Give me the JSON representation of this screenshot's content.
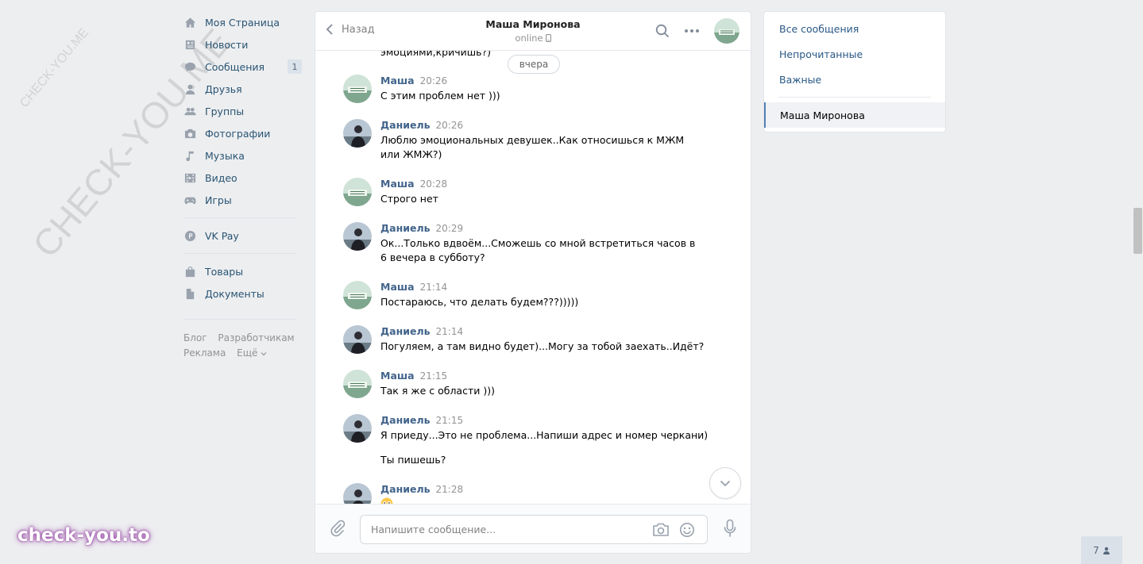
{
  "watermark": {
    "small": "CHECK-YOU.ME",
    "large": "CHECK-YOU.ME",
    "brand": "check-you.to"
  },
  "nav": {
    "items": [
      {
        "label": "Моя Страница",
        "icon": "home-icon"
      },
      {
        "label": "Новости",
        "icon": "news-icon"
      },
      {
        "label": "Сообщения",
        "icon": "messages-icon",
        "badge": "1"
      },
      {
        "label": "Друзья",
        "icon": "friend-icon"
      },
      {
        "label": "Группы",
        "icon": "groups-icon"
      },
      {
        "label": "Фотографии",
        "icon": "camera-icon"
      },
      {
        "label": "Музыка",
        "icon": "music-icon"
      },
      {
        "label": "Видео",
        "icon": "video-icon"
      },
      {
        "label": "Игры",
        "icon": "gamepad-icon"
      }
    ],
    "vkpay": {
      "label": "VK Pay",
      "icon": "vkpay-icon"
    },
    "extra": [
      {
        "label": "Товары",
        "icon": "bag-icon"
      },
      {
        "label": "Документы",
        "icon": "document-icon"
      }
    ],
    "footer": {
      "blog": "Блог",
      "dev": "Разработчикам",
      "ads": "Реклама",
      "more": "Ещё"
    }
  },
  "chat": {
    "back_label": "Назад",
    "peer_name": "Маша Миронова",
    "peer_status": "online",
    "cut_text": "эмоциями,кричишь?)",
    "date_pill": "вчера",
    "messages": [
      {
        "author": "Маша",
        "time": "20:26",
        "text": "С этим проблем нет )))"
      },
      {
        "author": "Даниель",
        "time": "20:26",
        "text": "Люблю эмоциональных девушек..Как относишься к МЖМ или ЖМЖ?)"
      },
      {
        "author": "Маша",
        "time": "20:28",
        "text": "Строго нет"
      },
      {
        "author": "Даниель",
        "time": "20:29",
        "text": "Ок...Только вдвоём...Сможешь со мной встретиться часов в 6 вечера в субботу?"
      },
      {
        "author": "Маша",
        "time": "21:14",
        "text": "Постараюсь, что делать будем???)))))"
      },
      {
        "author": "Даниель",
        "time": "21:14",
        "text": "Погуляем, а там видно будет)...Могу за тобой заехать..Идёт?"
      },
      {
        "author": "Маша",
        "time": "21:15",
        "text": "Так я же с области )))"
      },
      {
        "author": "Даниель",
        "time": "21:15",
        "text": "Я приеду...Это не проблема...Напиши адрес и номер черкани)",
        "text2": "Ты пишешь?"
      },
      {
        "author": "Даниель",
        "time": "21:28",
        "text": ""
      }
    ],
    "composer_placeholder": "Напишите сообщение..."
  },
  "filters": {
    "all": "Все сообщения",
    "unread": "Непрочитанные",
    "important": "Важные",
    "active": "Маша Миронова"
  },
  "online_count": "7",
  "colors": {
    "link": "#2a5885",
    "author": "#42648b",
    "accent": "#5181b8",
    "background": "#edeef0"
  }
}
